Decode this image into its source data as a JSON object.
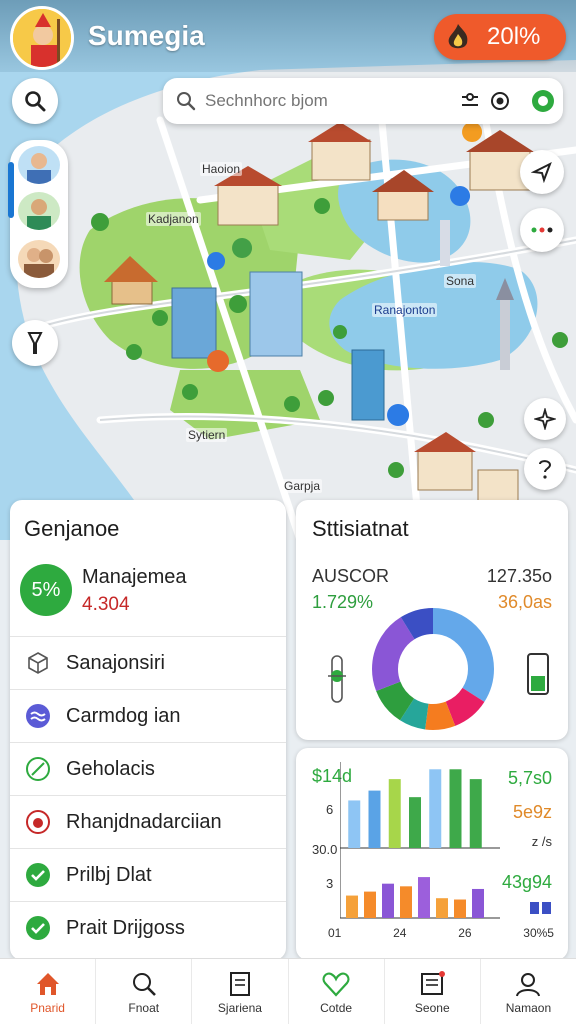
{
  "app": {
    "title": "Sumegia"
  },
  "score": {
    "label": "20l%"
  },
  "search": {
    "placeholder": "Sechnhorc bjom"
  },
  "map": {
    "labels": [
      "Haoion",
      "Kadjanon",
      "Sona",
      "Ranajonton",
      "Sytiern",
      "Garpja"
    ]
  },
  "left_panel": {
    "title": "Genjanoe",
    "progress": {
      "badge": "5%",
      "title": "Manajemea",
      "value": "4.304"
    },
    "items": [
      {
        "label": "Sanajonsiri",
        "icon": "cube-icon",
        "color": "#555555"
      },
      {
        "label": "Carmdog ian",
        "icon": "wave-icon",
        "color": "#5b5bd6"
      },
      {
        "label": "Geholacis",
        "icon": "leaf-icon",
        "color": "#2eaa3f"
      },
      {
        "label": "Rhanjdnadarciian",
        "icon": "animal-icon",
        "color": "#c62828"
      },
      {
        "label": "Prilbj Dlat",
        "icon": "check-circle-icon",
        "color": "#2eaa3f"
      },
      {
        "label": "Prait Drijgoss",
        "icon": "check-circle-icon",
        "color": "#2eaa3f"
      }
    ]
  },
  "stats_panel": {
    "title": "Sttisiatnat",
    "k1": "AUSCOR",
    "v1": "127.35o",
    "k2": "1.729%",
    "v2": "36,0as",
    "donut": [
      {
        "value": 34,
        "color": "#64a8ea"
      },
      {
        "value": 10,
        "color": "#e91e63"
      },
      {
        "value": 8,
        "color": "#f57c1f"
      },
      {
        "value": 7,
        "color": "#26a69a"
      },
      {
        "value": 10,
        "color": "#2e9e3e"
      },
      {
        "value": 22,
        "color": "#8a56d6"
      },
      {
        "value": 9,
        "color": "#3b4fc4"
      }
    ]
  },
  "bars_panel": {
    "top_left": "$14d",
    "top_right": "5,7s0",
    "y1": "6",
    "mid_right": "5e9z",
    "small_right": "z /s",
    "y2": "30.0",
    "y3": "3",
    "bottom_right": "43g94",
    "x_labels": [
      "01",
      "24",
      "26",
      "30%5"
    ]
  },
  "chart_data": [
    {
      "type": "bar",
      "values": [
        58,
        70,
        84,
        62,
        96,
        96,
        84
      ],
      "colors": [
        "#8ec5f4",
        "#5aa3e6",
        "#a7d64a",
        "#3ea94a",
        "#8ec5f4",
        "#3ea94a",
        "#3ea94a"
      ]
    },
    {
      "type": "bar",
      "values": [
        34,
        40,
        52,
        48,
        62,
        30,
        28,
        44
      ],
      "colors": [
        "#f5a13a",
        "#f58b2a",
        "#8a56d6",
        "#f58b2a",
        "#9c5fdc",
        "#f5a13a",
        "#f58b2a",
        "#8a56d6"
      ]
    }
  ],
  "nav": [
    {
      "label": "Pnarid",
      "icon": "home-icon",
      "active": true
    },
    {
      "label": "Fnoat",
      "icon": "search-tag-icon",
      "active": false
    },
    {
      "label": "Sjariena",
      "icon": "document-icon",
      "active": false
    },
    {
      "label": "Cotde",
      "icon": "heart-icon",
      "active": false
    },
    {
      "label": "Seone",
      "icon": "report-icon",
      "active": false
    },
    {
      "label": "Namaon",
      "icon": "user-icon",
      "active": false
    }
  ]
}
